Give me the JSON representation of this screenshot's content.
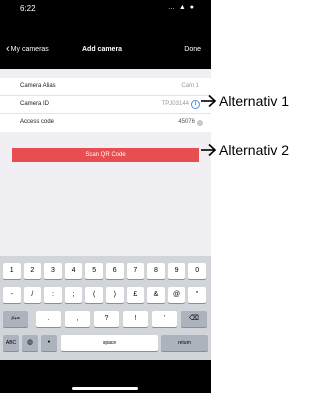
{
  "status_bar": {
    "time": "6:22",
    "icons": "… ▲ ●"
  },
  "nav": {
    "back_label": "My cameras",
    "title": "Add camera",
    "done_label": "Done"
  },
  "form": {
    "rows": [
      {
        "label": "Camera Alias",
        "value": "Cam 1"
      },
      {
        "label": "Camera ID",
        "value": "TPJ03144"
      },
      {
        "label": "Access code",
        "value": "45076"
      }
    ]
  },
  "scan_button": {
    "label": "Scan QR Code"
  },
  "keyboard": {
    "row1": [
      "1",
      "2",
      "3",
      "4",
      "5",
      "6",
      "7",
      "8",
      "9",
      "0"
    ],
    "row2": [
      "-",
      "/",
      ":",
      ";",
      "(",
      ")",
      "£",
      "&",
      "@",
      "\""
    ],
    "row3_left": "#+=",
    "row3": [
      ".",
      ",",
      "?",
      "!",
      "'"
    ],
    "row3_right": "⌫",
    "abc": "ABC",
    "globe": "◍",
    "mic": "•",
    "space": "space",
    "return": "return"
  },
  "callouts": [
    {
      "label": "Alternativ 1"
    },
    {
      "label": "Alternativ 2"
    }
  ]
}
